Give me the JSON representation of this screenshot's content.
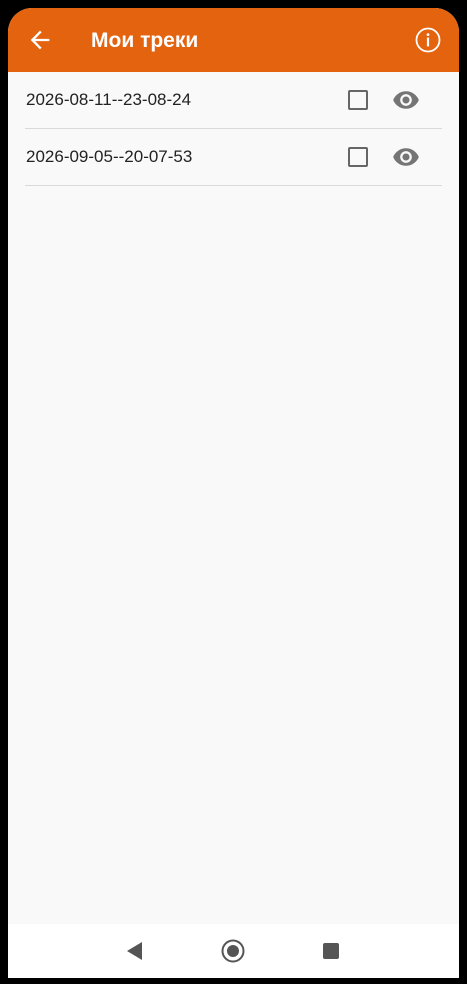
{
  "colors": {
    "appbar": "#e4630f",
    "background": "#f9f9f9",
    "text": "#222222",
    "icon_gray": "#757575",
    "divider": "#d9d9d9"
  },
  "appbar": {
    "title": "Мои треки",
    "back_icon": "arrow-back-icon",
    "info_icon": "info-icon"
  },
  "tracks": [
    {
      "name": "2026-08-11--23-08-24",
      "checked": false,
      "view_icon": "eye-icon"
    },
    {
      "name": "2026-09-05--20-07-53",
      "checked": false,
      "view_icon": "eye-icon"
    }
  ],
  "navbar": {
    "back_icon": "nav-back-triangle-icon",
    "home_icon": "nav-home-circle-icon",
    "recents_icon": "nav-recents-square-icon"
  }
}
